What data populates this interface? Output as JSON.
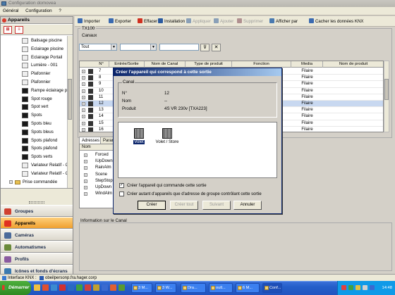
{
  "window": {
    "title": "Configuration domovea"
  },
  "menu": [
    "Général",
    "Configuration",
    "?"
  ],
  "left_panel": {
    "title": "Appareils",
    "tree_items": [
      {
        "label": "Balisage piscine",
        "style": "light"
      },
      {
        "label": "Eclairage piscine",
        "style": "light"
      },
      {
        "label": "Eclairage Portail",
        "style": "light"
      },
      {
        "label": "Lumière - 001",
        "style": "light"
      },
      {
        "label": "Plafonnier",
        "style": "light"
      },
      {
        "label": "Plafonnier",
        "style": "light"
      },
      {
        "label": "Rampe éclairage p",
        "style": "dark"
      },
      {
        "label": "Spot rouge",
        "style": "dark"
      },
      {
        "label": "Spot vert",
        "style": "dark"
      },
      {
        "label": "Spots",
        "style": "dark"
      },
      {
        "label": "Spots bleu",
        "style": "dark"
      },
      {
        "label": "Spots bleus",
        "style": "dark"
      },
      {
        "label": "Spots plafond",
        "style": "dark"
      },
      {
        "label": "Spots plafond",
        "style": "dark"
      },
      {
        "label": "Spots verts",
        "style": "dark"
      },
      {
        "label": "Variateur Relatif - C",
        "style": "light"
      },
      {
        "label": "Variateur Relatif - C",
        "style": "light"
      },
      {
        "label": "Prise commandée",
        "style": "group"
      }
    ],
    "nav": [
      {
        "label": "Groupes",
        "active": false,
        "color": "#d04030"
      },
      {
        "label": "Appareils",
        "active": true,
        "color": "#e03020"
      },
      {
        "label": "Caméras",
        "active": false,
        "color": "#4a6a9a"
      },
      {
        "label": "Automatismes",
        "active": false,
        "color": "#6a8a3a"
      },
      {
        "label": "Profils",
        "active": false,
        "color": "#8a5aa0"
      },
      {
        "label": "Icônes et fonds d'écrans",
        "active": false,
        "color": "#3a7ab0"
      }
    ]
  },
  "toolbar": {
    "items": [
      {
        "label": "Importer",
        "disabled": false,
        "color": "#3a6ab0"
      },
      {
        "label": "Exporter",
        "disabled": false,
        "color": "#3a6ab0"
      },
      {
        "label": "Effacer",
        "disabled": false,
        "color": "#d03020"
      },
      {
        "label": "Installation",
        "disabled": false,
        "color": "#2a5aa0"
      },
      {
        "label": "Appliquer",
        "disabled": true,
        "color": "#8aa0b8"
      },
      {
        "label": "Ajouter",
        "disabled": true,
        "color": "#8aa0b8"
      },
      {
        "label": "Supprimer",
        "disabled": true,
        "color": "#b09090"
      },
      {
        "label": "Afficher par",
        "disabled": false,
        "color": "#4a7ab0"
      },
      {
        "label": "Cacher les données KNX",
        "disabled": false,
        "color": "#3a6ab0"
      }
    ]
  },
  "main": {
    "group_title": "TX100",
    "canaux_label": "Canaux",
    "filter_value": "Tout",
    "columns": [
      "N°",
      "Entrée/Sortie",
      "Nom de Canal",
      "Type de produit",
      "Fonction",
      "Media",
      "Nom de produit"
    ],
    "rows": [
      {
        "n": "7",
        "media": "Filaire"
      },
      {
        "n": "8",
        "media": "Filaire"
      },
      {
        "n": "9",
        "media": "Filaire"
      },
      {
        "n": "10",
        "media": "Filaire"
      },
      {
        "n": "11",
        "media": "Filaire"
      },
      {
        "n": "12",
        "media": "Filaire",
        "selected": true
      },
      {
        "n": "13",
        "media": "Filaire"
      },
      {
        "n": "14",
        "media": "Filaire"
      },
      {
        "n": "15",
        "media": "Filaire"
      },
      {
        "n": "16",
        "media": "Filaire"
      }
    ],
    "lower_tabs": [
      "Adresses",
      "Param"
    ],
    "address_header": "Nom",
    "addresses": [
      "Forced",
      "IUpDown",
      "RainAlm",
      "Scene",
      "StepStop",
      "UpDown",
      "WindAlm"
    ],
    "info_label": "Information sur le Canal"
  },
  "dialog": {
    "title": "Créer l'appareil qui correspond à cette sortie",
    "canal_label": "Canal",
    "fields": [
      {
        "key": "N°",
        "value": "12"
      },
      {
        "key": "Nom",
        "value": "--"
      },
      {
        "key": "Produit",
        "value": "4S VR 230v [TXA223]"
      }
    ],
    "products": [
      {
        "label": "Volet",
        "selected": true
      },
      {
        "label": "Volet / Store",
        "selected": false
      }
    ],
    "options": [
      {
        "label": "Créer l'appareil qui commande cette sortie",
        "checked": true
      },
      {
        "label": "Créer autant d'appareils que d'adresse de groupe contrôlant cette sortie",
        "checked": false
      }
    ],
    "buttons": [
      {
        "label": "Créer",
        "disabled": false
      },
      {
        "label": "Créer tout",
        "disabled": true
      },
      {
        "label": "Suivant",
        "disabled": true
      },
      {
        "label": "Annuler",
        "disabled": false
      }
    ]
  },
  "status": {
    "text": "Interface KNX :",
    "host": "obeilpersonp.fra.hager.corp"
  },
  "taskbar": {
    "start": "Démarrer",
    "tasks": [
      "3 M...",
      "3 W...",
      "Dra...",
      "outl...",
      "6 M...",
      "Conf..."
    ],
    "clock": "14:48"
  }
}
